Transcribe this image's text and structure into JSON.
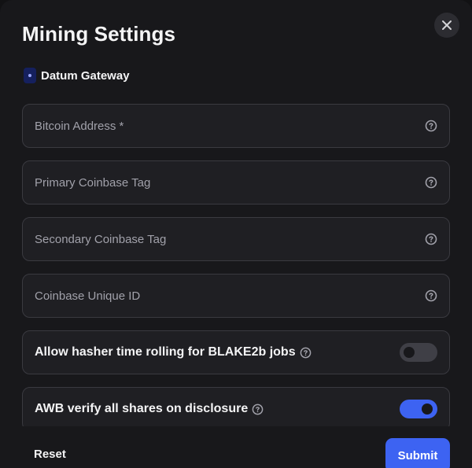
{
  "modal": {
    "title": "Mining Settings",
    "close_icon": "close-icon"
  },
  "service": {
    "name": "Datum Gateway",
    "icon": "datum-app-icon"
  },
  "fields": [
    {
      "placeholder": "Bitcoin Address *",
      "value": "",
      "help_icon": "help-icon"
    },
    {
      "placeholder": "Primary Coinbase Tag",
      "value": "",
      "help_icon": "help-icon"
    },
    {
      "placeholder": "Secondary Coinbase Tag",
      "value": "",
      "help_icon": "help-icon"
    },
    {
      "placeholder": "Coinbase Unique ID",
      "value": "",
      "help_icon": "help-icon"
    }
  ],
  "toggles": [
    {
      "label": "Allow hasher time rolling for BLAKE2b jobs",
      "enabled": false,
      "help_icon": "help-icon"
    },
    {
      "label": "AWB verify all shares on disclosure",
      "enabled": true,
      "help_icon": "help-icon"
    }
  ],
  "footer": {
    "reset_label": "Reset",
    "submit_label": "Submit"
  },
  "colors": {
    "accent": "#3d63f2",
    "background": "#18181b",
    "field_background": "#1f1f23",
    "border": "#3a3a40"
  }
}
